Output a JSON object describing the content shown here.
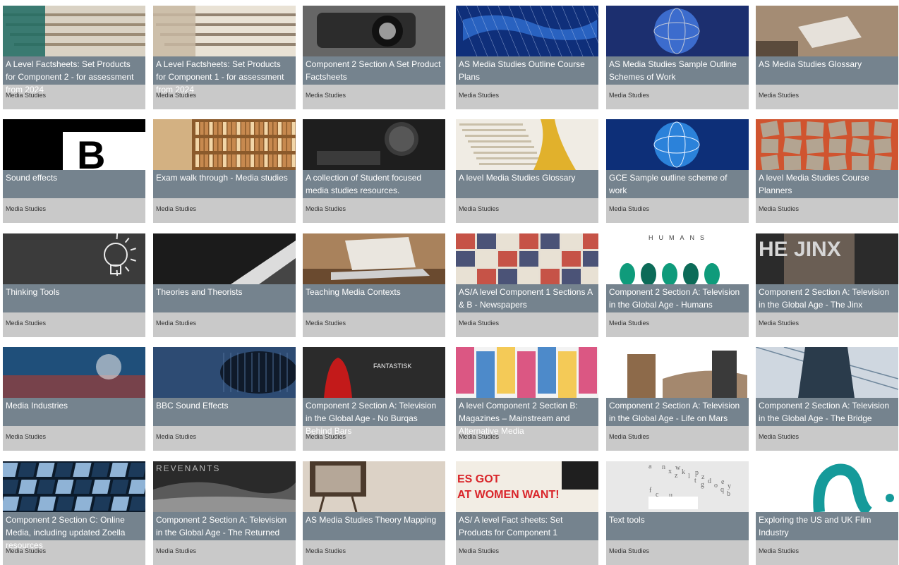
{
  "subject": "Media Studies",
  "cards": [
    {
      "title": "A Level Factsheets: Set Products for Component 2 - for assessment from 2024",
      "image": "papers",
      "colors": [
        "#1d6b63",
        "#d9d2c4",
        "#8c7a63"
      ]
    },
    {
      "title": "A Level Factsheets: Set Products for Component 1 - for assessment from 2024",
      "image": "papers",
      "colors": [
        "#c8b9a2",
        "#e9e2d5",
        "#7d6b57"
      ]
    },
    {
      "title": "Component 2 Section A Set Product Factsheets",
      "image": "camera",
      "colors": [
        "#2c2c2c",
        "#666666",
        "#9a9a9a"
      ]
    },
    {
      "title": "AS Media Studies Outline Course Plans",
      "image": "world-map",
      "colors": [
        "#0f2f7a",
        "#2f6fd2",
        "#b8c9ef"
      ]
    },
    {
      "title": "AS Media Studies Sample Outline Schemes of Work",
      "image": "globe",
      "colors": [
        "#1c2f6f",
        "#3c6ccd",
        "#c3cad9"
      ]
    },
    {
      "title": "AS Media Studies Glossary",
      "image": "reading",
      "colors": [
        "#a48c74",
        "#e6e1da",
        "#5b4b3c"
      ]
    },
    {
      "title": "Sound effects",
      "image": "letter-b",
      "colors": [
        "#000000",
        "#ffffff",
        "#000000"
      ]
    },
    {
      "title": "Exam walk through - Media studies",
      "image": "bookshelf",
      "colors": [
        "#8b5a2b",
        "#c7894f",
        "#f2d6a8"
      ]
    },
    {
      "title": "A collection of Student focused media studies resources.",
      "image": "microphone",
      "colors": [
        "#1e1e1e",
        "#3b3b3b",
        "#6a6a6a"
      ]
    },
    {
      "title": "A level Media Studies Glossary",
      "image": "dictionary",
      "colors": [
        "#f0ece4",
        "#c9bfa9",
        "#e1b12c"
      ]
    },
    {
      "title": "GCE Sample outline scheme of work",
      "image": "globe",
      "colors": [
        "#0d2f78",
        "#2b82da",
        "#e8f1ff"
      ]
    },
    {
      "title": "A level Media Studies Course Planners",
      "image": "tiles",
      "colors": [
        "#d0542f",
        "#b3a491",
        "#6f5c4a"
      ]
    },
    {
      "title": "Thinking Tools",
      "image": "bulb",
      "colors": [
        "#3b3b3b",
        "#555555",
        "#eaeaea"
      ]
    },
    {
      "title": "Theories and Theorists",
      "image": "laptop-dark",
      "colors": [
        "#1b1b1b",
        "#454545",
        "#dcdcdc"
      ]
    },
    {
      "title": "Teaching Media Contexts",
      "image": "laptop",
      "colors": [
        "#6a4a2f",
        "#a9825c",
        "#eae6df"
      ]
    },
    {
      "title": "AS/A level Component 1 Sections A & B - Newspapers",
      "image": "newspapers",
      "colors": [
        "#bf3a2e",
        "#e7e0d4",
        "#2f3a66"
      ]
    },
    {
      "title": "Component 2 Section A: Television in the Global Age - Humans",
      "image": "humans",
      "colors": [
        "#ffffff",
        "#0f9b7b",
        "#0c6b58"
      ]
    },
    {
      "title": "Component 2 Section A: Television in the Global Age - The Jinx",
      "image": "jinx",
      "colors": [
        "#2b2b2b",
        "#7a6b5f",
        "#d6d6d6"
      ]
    },
    {
      "title": "Media Industries",
      "image": "studio",
      "colors": [
        "#1f4f7a",
        "#b23b2b",
        "#e6e6e6"
      ]
    },
    {
      "title": "BBC Sound Effects",
      "image": "mic-blue",
      "colors": [
        "#2d4b73",
        "#0f1a2a",
        "#4e6f98"
      ]
    },
    {
      "title": "Component 2 Section A: Television in the Global Age - No Burqas Behind Bars",
      "image": "red-figure",
      "colors": [
        "#2b2b2b",
        "#c31a1a",
        "#f1f1f1"
      ]
    },
    {
      "title": "A level Component 2 Section B: Magazines – Mainstream and Alternative Media",
      "image": "magazines",
      "colors": [
        "#d63b6f",
        "#2f77c2",
        "#f3c23b"
      ]
    },
    {
      "title": "Component 2 Section A: Television in the Global Age - Life on Mars",
      "image": "life-on-mars",
      "colors": [
        "#ffffff",
        "#8d6a4a",
        "#3a3a3a"
      ]
    },
    {
      "title": "Component 2 Section A: Television in the Global Age - The Bridge",
      "image": "bridge",
      "colors": [
        "#cfd7e0",
        "#2a3b4b",
        "#6f879c"
      ]
    },
    {
      "title": "Component 2 Section C: Online Media, including updated Zoella resources",
      "image": "screens",
      "colors": [
        "#1c3a5a",
        "#8fb3d6",
        "#0b1a2a"
      ]
    },
    {
      "title": "Component 2 Section A: Television in the Global Age - The Returned",
      "image": "returned",
      "colors": [
        "#2a2a2a",
        "#b9b9b9",
        "#5a5a5a"
      ]
    },
    {
      "title": "AS Media Studies Theory Mapping",
      "image": "tv",
      "colors": [
        "#dcd2c6",
        "#4b3a2c",
        "#b5a798"
      ]
    },
    {
      "title": "AS/ A level Fact sheets: Set Products for Component 1",
      "image": "adverts",
      "colors": [
        "#d9252a",
        "#f2ede4",
        "#1f1f1f"
      ]
    },
    {
      "title": "Text tools",
      "image": "letters",
      "colors": [
        "#e8e8e8",
        "#6a6a6a",
        "#ffffff"
      ]
    },
    {
      "title": "Exploring the US and UK Film Industry",
      "image": "logo",
      "colors": [
        "#ffffff",
        "#159a9a",
        "#ffffff"
      ]
    }
  ]
}
